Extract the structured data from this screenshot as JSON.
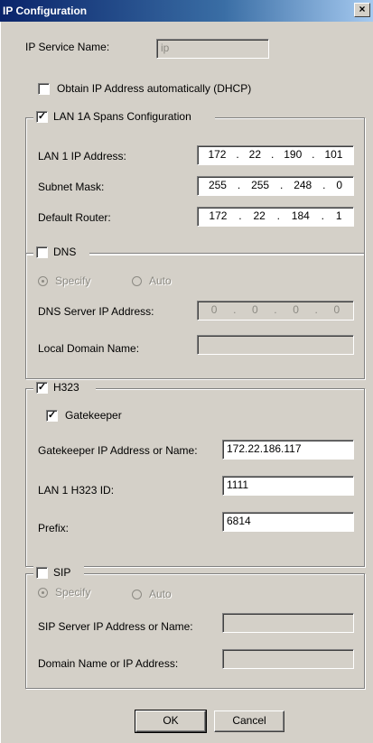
{
  "window": {
    "title": "IP Configuration",
    "close_glyph": "×"
  },
  "ip_service": {
    "label": "IP Service Name:",
    "value": "ip"
  },
  "dhcp": {
    "label": "Obtain IP Address automatically (DHCP)",
    "checked": false
  },
  "lan": {
    "legend": "LAN 1A Spans Configuration",
    "checked": true,
    "ip_label": "LAN 1 IP Address:",
    "ip": [
      "172",
      "22",
      "190",
      "101"
    ],
    "mask_label": "Subnet Mask:",
    "mask": [
      "255",
      "255",
      "248",
      "0"
    ],
    "router_label": "Default Router:",
    "router": [
      "172",
      "22",
      "184",
      "1"
    ]
  },
  "dns": {
    "legend": "DNS",
    "checked": false,
    "specify_label": "Specify",
    "auto_label": "Auto",
    "server_label": "DNS Server IP Address:",
    "server": [
      "0",
      "0",
      "0",
      "0"
    ],
    "domain_label": "Local Domain Name:",
    "domain": ""
  },
  "h323": {
    "legend": "H323",
    "checked": true,
    "gatekeeper_label": "Gatekeeper",
    "gatekeeper_checked": true,
    "gk_addr_label": "Gatekeeper IP Address or Name:",
    "gk_addr": "172.22.186.117",
    "id_label": "LAN 1 H323 ID:",
    "id": "1111",
    "prefix_label": "Prefix:",
    "prefix": "6814"
  },
  "sip": {
    "legend": "SIP",
    "checked": false,
    "specify_label": "Specify",
    "auto_label": "Auto",
    "server_label": "SIP Server IP Address or Name:",
    "server": "",
    "domain_label": "Domain Name or IP Address:",
    "domain": ""
  },
  "buttons": {
    "ok": "OK",
    "cancel": "Cancel"
  },
  "ip_separator": "."
}
